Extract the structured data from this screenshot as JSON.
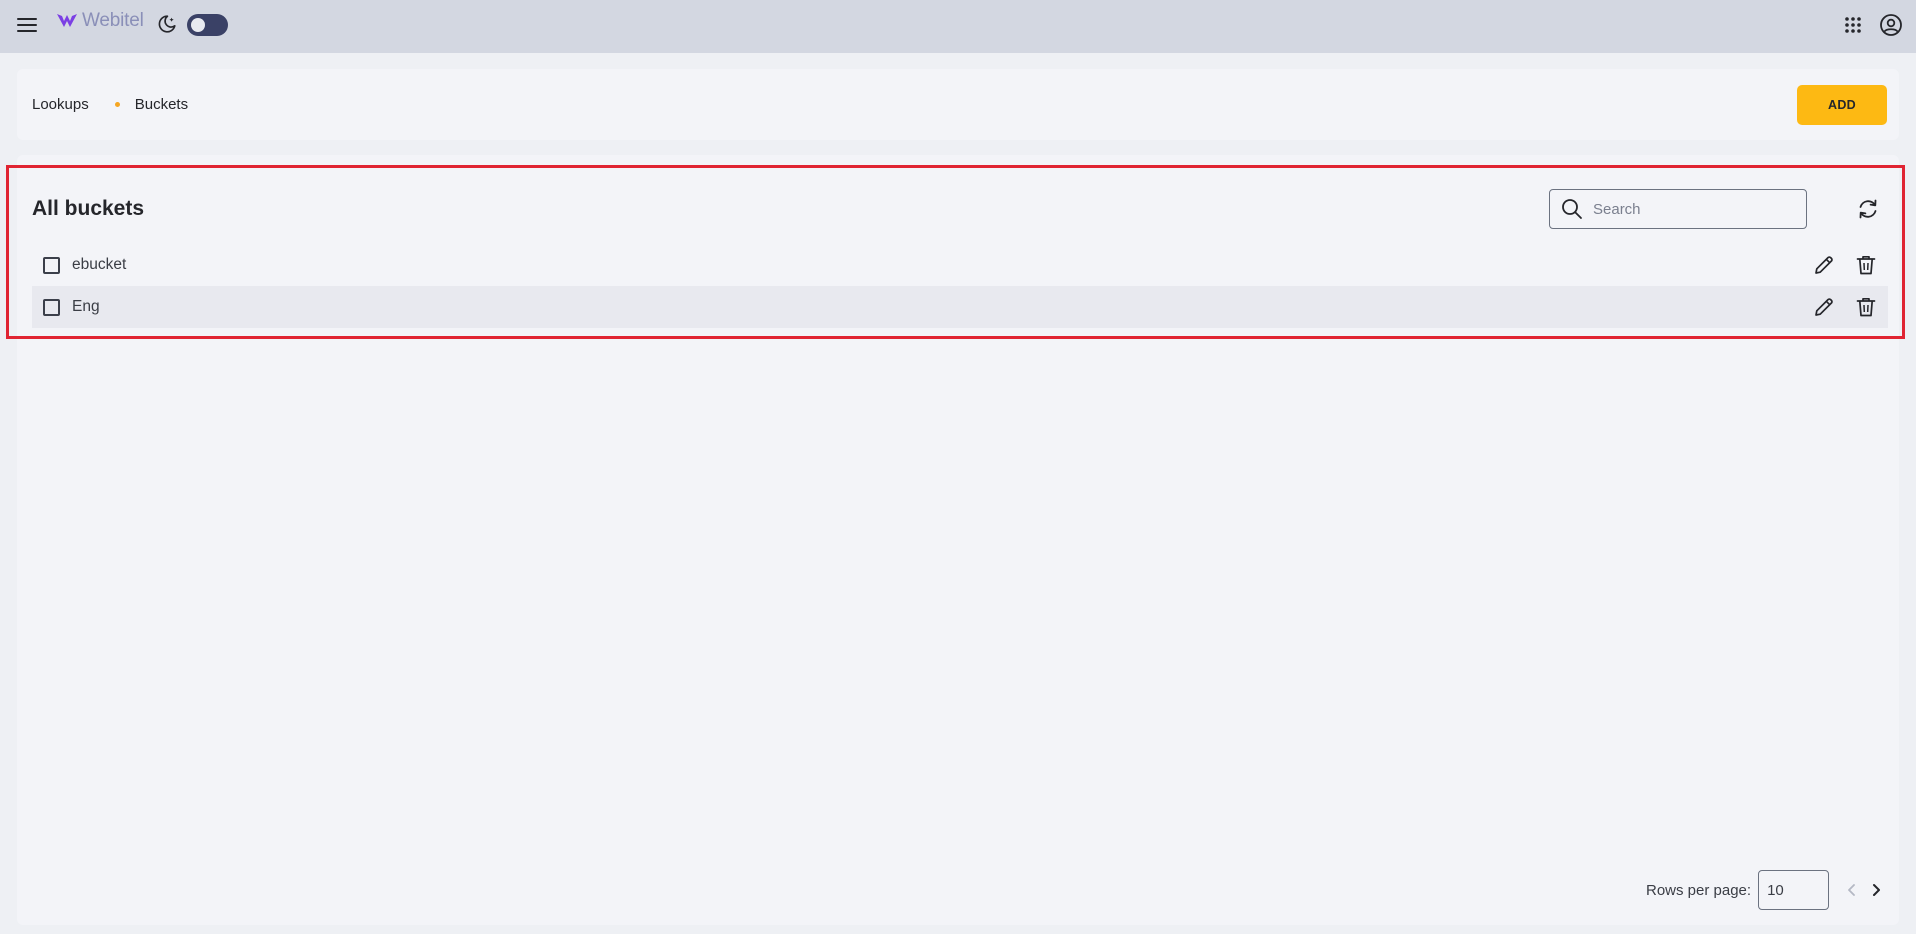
{
  "header": {
    "brand": "Webitel",
    "icons": {
      "menu": "hamburger-menu-icon",
      "theme": "moon-star-icon",
      "apps": "apps-grid-icon",
      "account": "account-circle-icon"
    },
    "theme_toggle_on": false
  },
  "breadcrumb": {
    "items": [
      "Lookups",
      "Buckets"
    ]
  },
  "toolbar": {
    "add_label": "ADD"
  },
  "section": {
    "title": "All buckets",
    "search_placeholder": "Search"
  },
  "table": {
    "rows": [
      {
        "name": "ebucket",
        "checked": false
      },
      {
        "name": "Eng",
        "checked": false
      }
    ]
  },
  "pagination": {
    "rows_per_page_label": "Rows per page:",
    "rows_per_page_value": "10"
  },
  "colors": {
    "accent": "#fdb913",
    "highlight_border": "#e02432",
    "topbar": "#d3d7e1",
    "toggle": "#3a4166"
  }
}
